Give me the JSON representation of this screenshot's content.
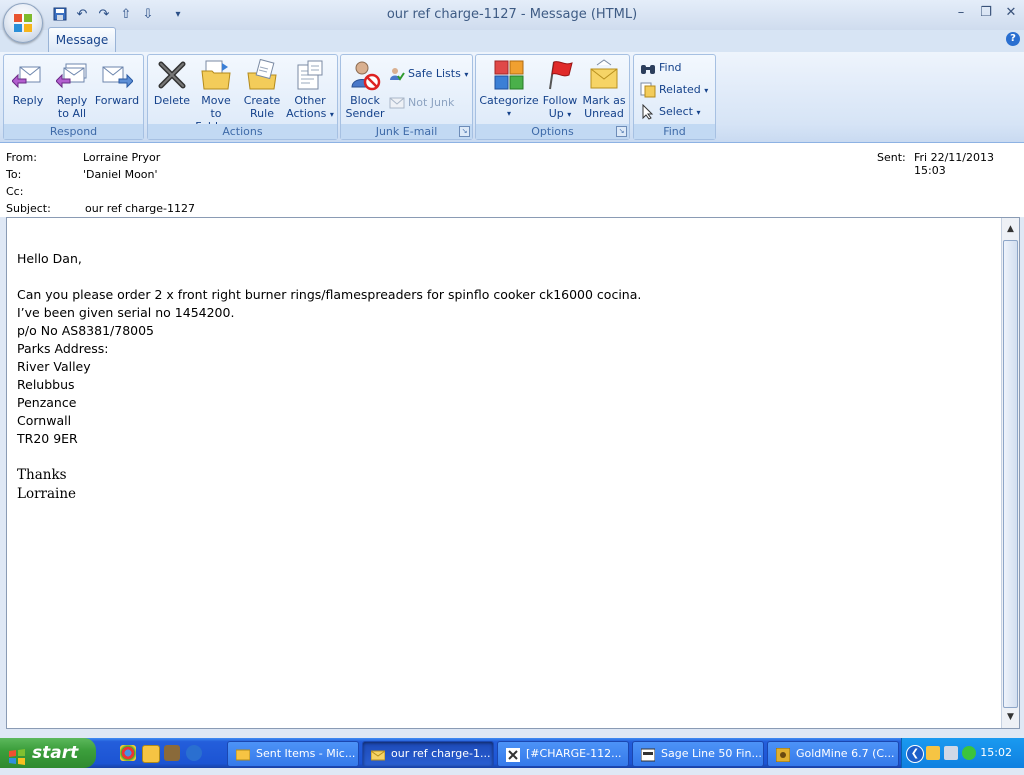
{
  "window": {
    "title": "our ref charge-1127  -  Message (HTML)",
    "controls": {
      "minimize": "–",
      "restore": "❐",
      "close": "✕"
    },
    "help": "?"
  },
  "tabs": [
    {
      "label": "Message"
    }
  ],
  "ribbon": {
    "respond": {
      "label": "Respond",
      "reply": "Reply",
      "reply_all_1": "Reply",
      "reply_all_2": "to All",
      "forward": "Forward"
    },
    "actions": {
      "label": "Actions",
      "delete": "Delete",
      "move_1": "Move to",
      "move_2": "Folder",
      "create_1": "Create",
      "create_2": "Rule",
      "other_1": "Other",
      "other_2": "Actions"
    },
    "junk": {
      "label": "Junk E-mail",
      "block_1": "Block",
      "block_2": "Sender",
      "safe_lists": "Safe Lists",
      "not_junk": "Not Junk"
    },
    "options": {
      "label": "Options",
      "categorize": "Categorize",
      "follow_1": "Follow",
      "follow_2": "Up",
      "mark_1": "Mark as",
      "mark_2": "Unread"
    },
    "find": {
      "label": "Find",
      "find": "Find",
      "related": "Related",
      "select": "Select"
    }
  },
  "header": {
    "from_label": "From:",
    "from": "Lorraine Pryor",
    "to_label": "To:",
    "to": "'Daniel Moon'",
    "cc_label": "Cc:",
    "cc": "",
    "subject_label": "Subject:",
    "subject": "our ref charge-1127",
    "sent_label": "Sent:",
    "sent": "Fri 22/11/2013 15:03"
  },
  "body": {
    "greeting": "Hello Dan,",
    "lines": [
      "Can you please order 2 x front right burner rings/flamespreaders for spinflo cooker ck16000 cocina.",
      "I’ve been given serial no 1454200.",
      "p/o No AS8381/78005",
      "Parks Address:",
      "River Valley",
      "Relubbus",
      "Penzance",
      "Cornwall",
      "TR20 9ER"
    ],
    "thanks": "Thanks",
    "signature": "Lorraine"
  },
  "taskbar": {
    "start": "start",
    "tasks": [
      {
        "label": "Sent Items - Mic..."
      },
      {
        "label": "our ref charge-1..."
      },
      {
        "label": "[#CHARGE-112..."
      },
      {
        "label": "Sage Line 50 Fin..."
      },
      {
        "label": "GoldMine 6.7 (C..."
      }
    ],
    "clock": "15:02"
  },
  "colors": {
    "ribbon_text": "#15428b",
    "taskbar": "#245edb",
    "start": "#3c9f3c"
  }
}
